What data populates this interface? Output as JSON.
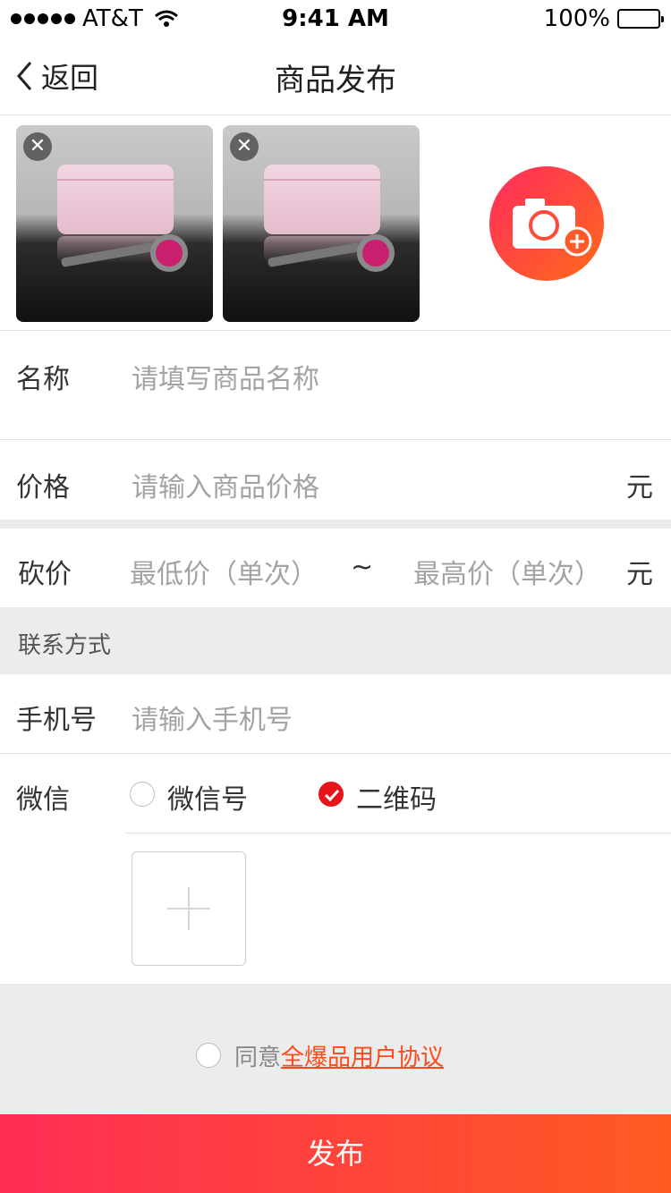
{
  "status_bar": {
    "carrier": "AT&T",
    "time": "9:41 AM",
    "battery": "100%"
  },
  "nav": {
    "back_label": "返回",
    "title": "商品发布"
  },
  "photos": {
    "count": 2
  },
  "form": {
    "name": {
      "label": "名称",
      "placeholder": "请填写商品名称"
    },
    "price": {
      "label": "价格",
      "placeholder": "请输入商品价格",
      "unit": "元"
    },
    "bargain": {
      "label": "砍价",
      "min_placeholder": "最低价（单次）",
      "separator": "~",
      "max_placeholder": "最高价（单次）",
      "unit": "元"
    }
  },
  "contact": {
    "section_title": "联系方式",
    "phone": {
      "label": "手机号",
      "placeholder": "请输入手机号"
    },
    "wechat": {
      "label": "微信",
      "option_id": "微信号",
      "option_qr": "二维码",
      "selected": "二维码"
    }
  },
  "agreement": {
    "prefix": "同意",
    "link_text": "全爆品用户协议"
  },
  "submit_label": "发布",
  "colors": {
    "accent": "#ff4a1a",
    "check": "#e8141c",
    "gradient_start": "#ff2d55",
    "gradient_end": "#ff5a22"
  }
}
